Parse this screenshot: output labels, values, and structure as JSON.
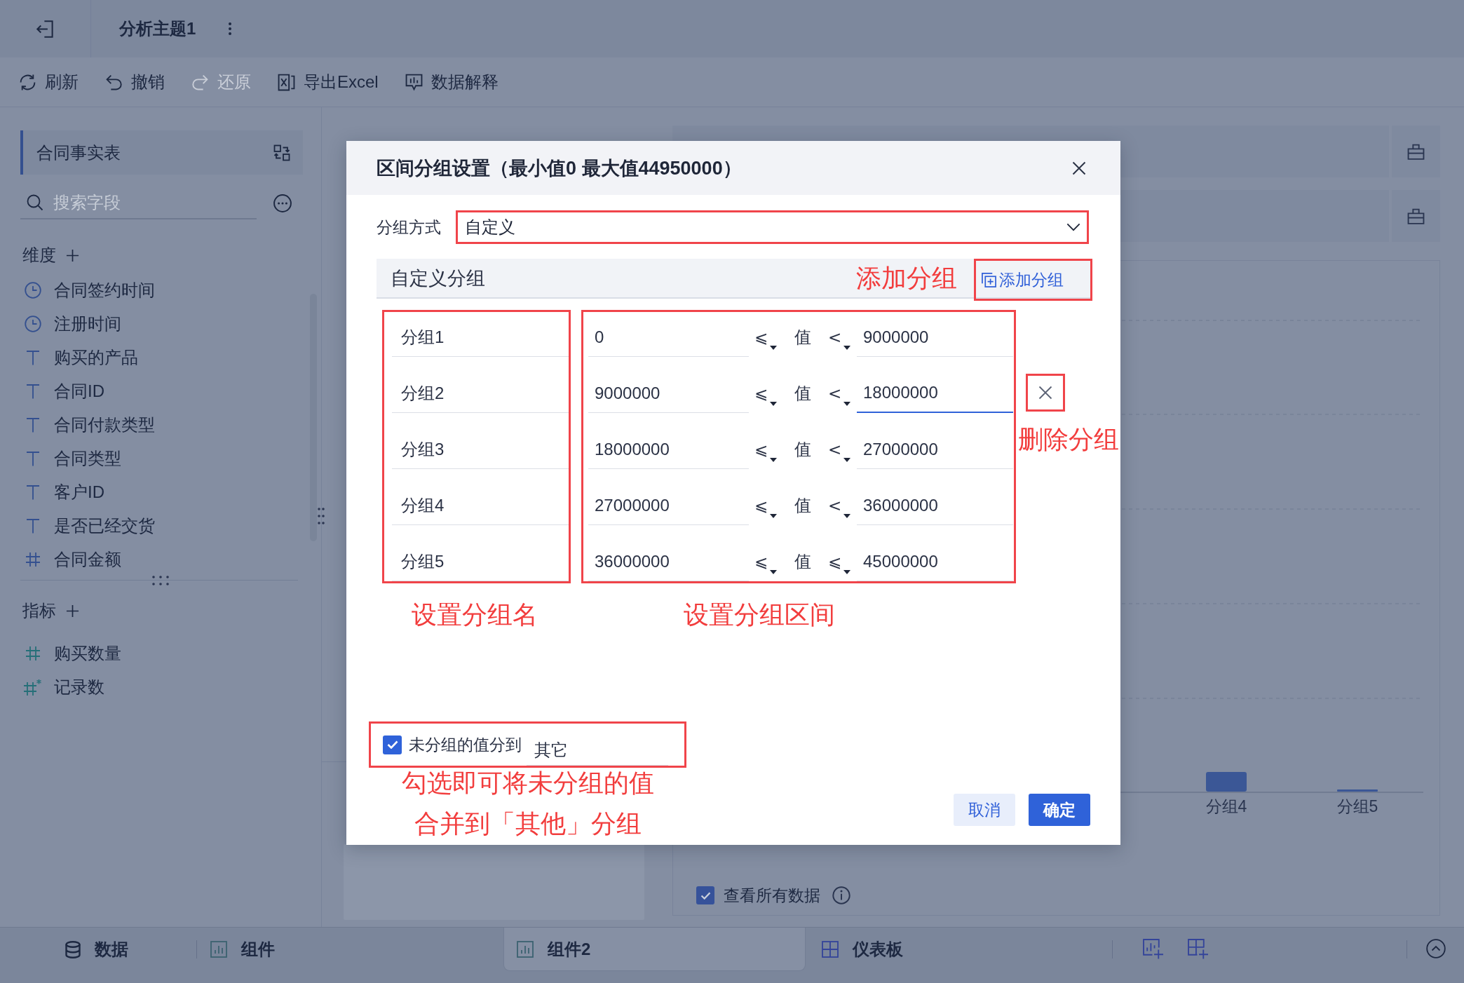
{
  "header": {
    "title": "分析主题1"
  },
  "toolbar": [
    {
      "label": "刷新",
      "kind": "refresh",
      "disabled": false
    },
    {
      "label": "撤销",
      "kind": "undo",
      "disabled": false
    },
    {
      "label": "还原",
      "kind": "redo",
      "disabled": true
    },
    {
      "label": "导出Excel",
      "kind": "export",
      "disabled": false
    },
    {
      "label": "数据解释",
      "kind": "explain",
      "disabled": false
    }
  ],
  "sidebar": {
    "table": "合同事实表",
    "search": {
      "placeholder": "搜索字段"
    },
    "sections": [
      {
        "title": "维度",
        "fields": [
          {
            "name": "合同签约时间",
            "kind": "date"
          },
          {
            "name": "注册时间",
            "kind": "date"
          },
          {
            "name": "购买的产品",
            "kind": "text"
          },
          {
            "name": "合同ID",
            "kind": "text"
          },
          {
            "name": "合同付款类型",
            "kind": "text"
          },
          {
            "name": "合同类型",
            "kind": "text"
          },
          {
            "name": "客户ID",
            "kind": "text"
          },
          {
            "name": "是否已经交货",
            "kind": "text"
          },
          {
            "name": "合同金额",
            "kind": "number"
          }
        ]
      },
      {
        "title": "指标",
        "fields": [
          {
            "name": "购买数量",
            "kind": "measure"
          },
          {
            "name": "记录数",
            "kind": "count"
          }
        ]
      }
    ]
  },
  "chart": {
    "categories": [
      "分组4",
      "分组5"
    ],
    "view_all": {
      "label": "查看所有数据",
      "checked": true
    }
  },
  "dialog": {
    "title": "区间分组设置（最小值0 最大值44950000）",
    "method": {
      "label": "分组方式",
      "value": "自定义"
    },
    "custom": {
      "title": "自定义分组",
      "add_label": "添加分组"
    },
    "groups": [
      {
        "name": "分组1",
        "min": "0",
        "min_op": "⩽",
        "value_label": "值",
        "max_op": "<",
        "max": "9000000",
        "hovered": false,
        "focused": false
      },
      {
        "name": "分组2",
        "min": "9000000",
        "min_op": "⩽",
        "value_label": "值",
        "max_op": "<",
        "max": "18000000",
        "hovered": true,
        "focused": true
      },
      {
        "name": "分组3",
        "min": "18000000",
        "min_op": "⩽",
        "value_label": "值",
        "max_op": "<",
        "max": "27000000",
        "hovered": false,
        "focused": false
      },
      {
        "name": "分组4",
        "min": "27000000",
        "min_op": "⩽",
        "value_label": "值",
        "max_op": "<",
        "max": "36000000",
        "hovered": false,
        "focused": false
      },
      {
        "name": "分组5",
        "min": "36000000",
        "min_op": "⩽",
        "value_label": "值",
        "max_op": "⩽",
        "max": "45000000",
        "hovered": false,
        "focused": false
      }
    ],
    "other": {
      "checked": true,
      "label": "未分组的值分到",
      "value": "其它"
    },
    "buttons": [
      {
        "label": "取消",
        "kind": "secondary"
      },
      {
        "label": "确定",
        "kind": "primary"
      }
    ],
    "notes": {
      "add": "添加分组",
      "delete": "删除分组",
      "names": "设置分组名",
      "ranges": "设置分组区间",
      "other": [
        "勾选即可将未分组的值",
        "合并到「其他」分组"
      ]
    }
  },
  "bottom_tabs": [
    {
      "label": "数据",
      "kind": "data",
      "selected": false
    },
    {
      "label": "组件",
      "kind": "component",
      "selected": false
    },
    {
      "label": "组件2",
      "kind": "component",
      "selected": true
    },
    {
      "label": "仪表板",
      "kind": "dashboard",
      "selected": false
    }
  ]
}
